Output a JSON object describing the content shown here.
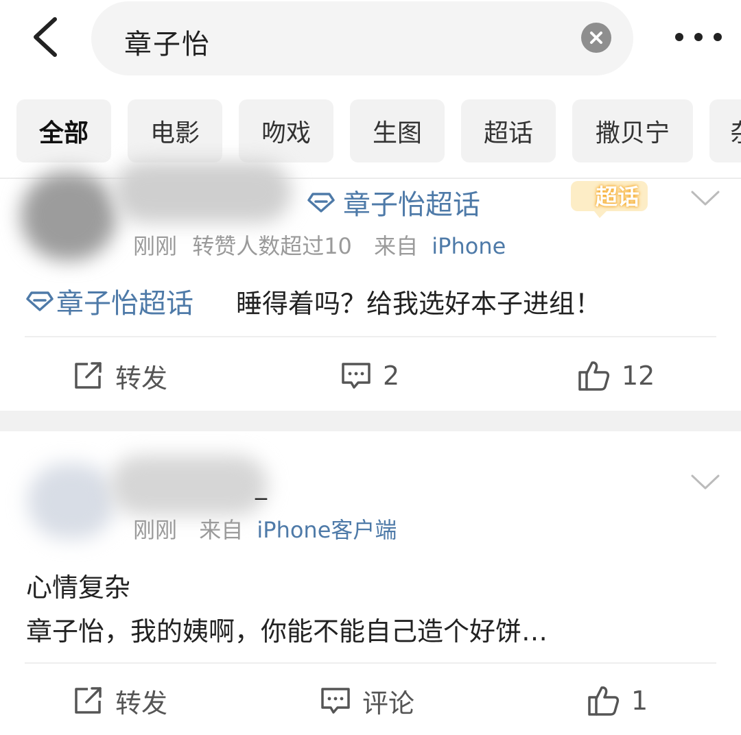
{
  "search": {
    "query": "章子怡"
  },
  "tabs": [
    "全部",
    "电影",
    "吻戏",
    "生图",
    "超话",
    "撒贝宁",
    "杂"
  ],
  "posts": [
    {
      "topic_tag": "章子怡超话",
      "meta_time": "刚刚",
      "meta_note": "转赞人数超过10",
      "meta_from": "来自",
      "meta_source": "iPhone",
      "body_topic": "章子怡超话",
      "body_text": "睡得着吗？给我选好本子进组！",
      "badge": "超话",
      "actions": {
        "repost": "转发",
        "comment": "2",
        "like": "12"
      }
    },
    {
      "name_suffix": "_",
      "meta_time": "刚刚",
      "meta_from": "来自",
      "meta_source": "iPhone客户端",
      "body_line1": "心情复杂",
      "body_line2": "章子怡，我的姨啊，你能不能自己造个好饼…",
      "actions": {
        "repost": "转发",
        "comment": "评论",
        "like": "1"
      }
    }
  ],
  "colors": {
    "link": "#4e7aa8",
    "meta": "#9a9a9a",
    "badge": "#f5a623"
  }
}
